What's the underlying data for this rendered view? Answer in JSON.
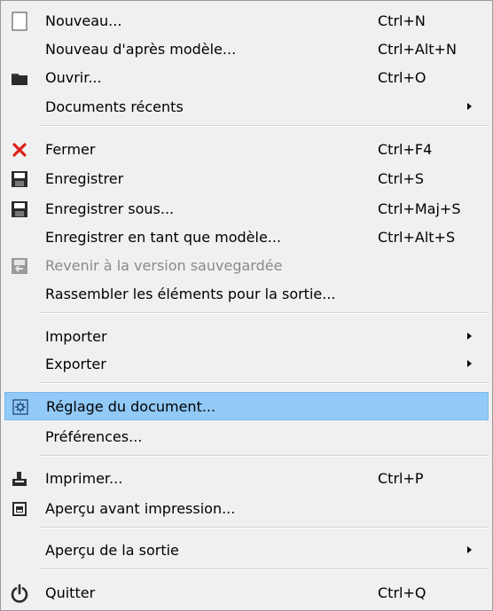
{
  "menu": {
    "items": [
      {
        "label": "Nouveau...",
        "shortcut": "Ctrl+N",
        "icon": "new-document-icon"
      },
      {
        "label": "Nouveau d'après modèle...",
        "shortcut": "Ctrl+Alt+N"
      },
      {
        "label": "Ouvrir...",
        "shortcut": "Ctrl+O",
        "icon": "open-folder-icon"
      },
      {
        "label": "Documents récents",
        "submenu": true
      },
      {
        "label": "Fermer",
        "shortcut": "Ctrl+F4",
        "icon": "close-icon"
      },
      {
        "label": "Enregistrer",
        "shortcut": "Ctrl+S",
        "icon": "save-icon"
      },
      {
        "label": "Enregistrer sous...",
        "shortcut": "Ctrl+Maj+S",
        "icon": "save-as-icon"
      },
      {
        "label": "Enregistrer en tant que modèle...",
        "shortcut": "Ctrl+Alt+S"
      },
      {
        "label": "Revenir à la version sauvegardée",
        "disabled": true,
        "icon": "revert-icon"
      },
      {
        "label": "Rassembler les éléments pour la sortie..."
      },
      {
        "label": "Importer",
        "submenu": true
      },
      {
        "label": "Exporter",
        "submenu": true
      },
      {
        "label": "Réglage du document...",
        "highlighted": true,
        "icon": "document-setup-icon"
      },
      {
        "label": "Préférences..."
      },
      {
        "label": "Imprimer...",
        "shortcut": "Ctrl+P",
        "icon": "print-icon"
      },
      {
        "label": "Aperçu avant impression...",
        "icon": "print-preview-icon"
      },
      {
        "label": "Aperçu de la sortie",
        "submenu": true
      },
      {
        "label": "Quitter",
        "shortcut": "Ctrl+Q",
        "icon": "power-icon"
      }
    ]
  },
  "colors": {
    "highlight": "#91c9f7",
    "close_icon": "#e0201a",
    "disabled_text": "#8a8a8a"
  }
}
